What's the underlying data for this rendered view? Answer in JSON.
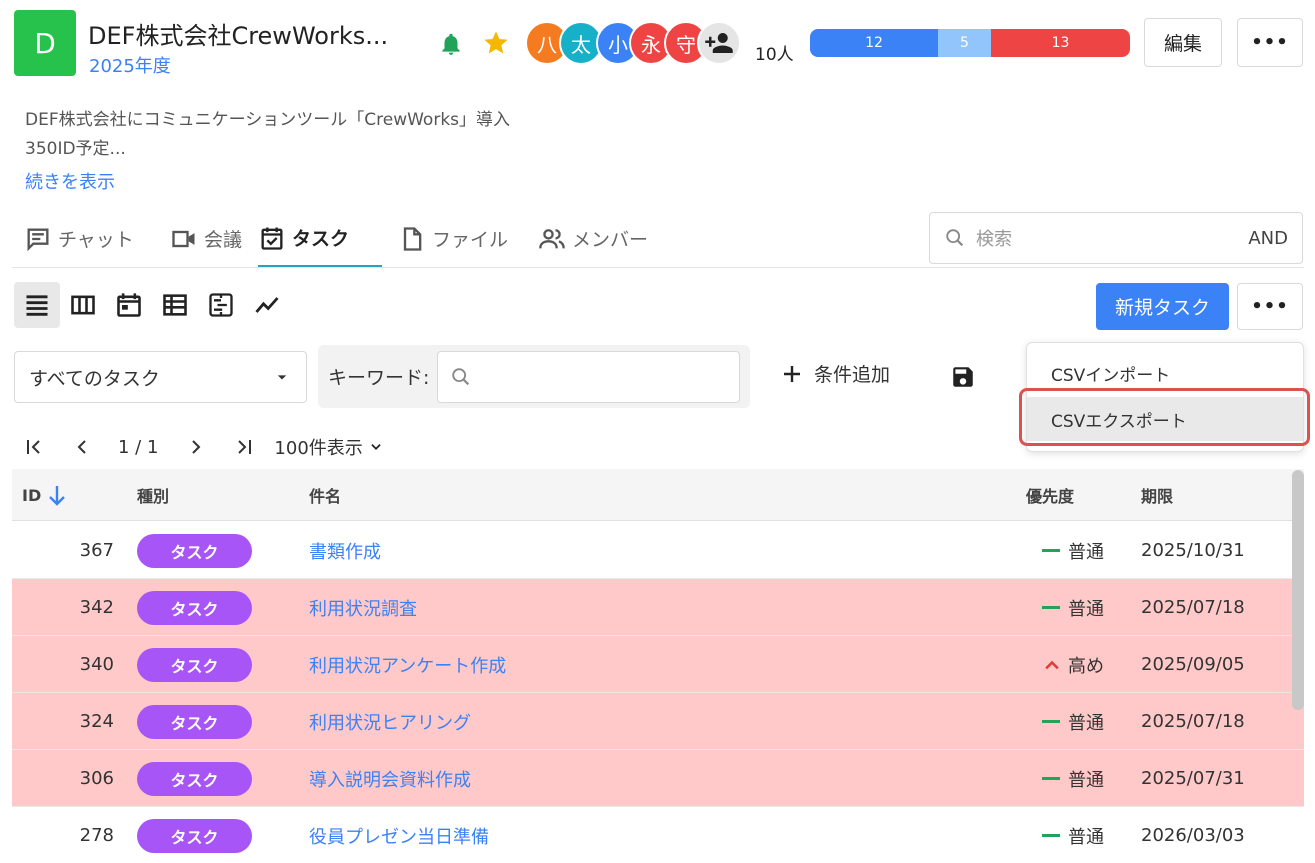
{
  "project": {
    "icon_letter": "D",
    "title": "DEF株式会社CrewWorks...",
    "year": "2025年度",
    "description_line1": "DEF株式会社にコミュニケーションツール「CrewWorks」導入",
    "description_line2": "350ID予定...",
    "show_more": "続きを表示",
    "member_count": "10人",
    "avatars": [
      {
        "char": "八",
        "color": "#f47b20"
      },
      {
        "char": "太",
        "color": "#16b0c8"
      },
      {
        "char": "小",
        "color": "#3b82f6"
      },
      {
        "char": "永",
        "color": "#ef4444"
      },
      {
        "char": "守",
        "color": "#ef4444"
      }
    ],
    "status_counts": [
      {
        "value": "12",
        "color": "#3b82f6"
      },
      {
        "value": "5",
        "color": "#93c5fd"
      },
      {
        "value": "13",
        "color": "#ef4444"
      }
    ],
    "edit_label": "編集",
    "more_label": "•••"
  },
  "tabs": [
    {
      "label": "チャット",
      "icon": "chat-icon"
    },
    {
      "label": "会議",
      "icon": "video-icon"
    },
    {
      "label": "タスク",
      "icon": "task-icon"
    },
    {
      "label": "ファイル",
      "icon": "file-icon"
    },
    {
      "label": "メンバー",
      "icon": "members-icon"
    }
  ],
  "search": {
    "placeholder": "検索",
    "mode": "AND"
  },
  "toolbar": {
    "new_task": "新規タスク",
    "more_label": "•••"
  },
  "filter": {
    "selected": "すべてのタスク",
    "keyword_label": "キーワード:",
    "add_condition": "条件追加"
  },
  "dropdown": {
    "items": [
      "CSVインポート",
      "CSVエクスポート"
    ]
  },
  "pager": {
    "page": "1 / 1",
    "per_page": "100件表示"
  },
  "table": {
    "headers": {
      "id": "ID",
      "type": "種別",
      "name": "件名",
      "priority": "優先度",
      "due": "期限"
    },
    "rows": [
      {
        "id": "367",
        "type": "タスク",
        "name": "書類作成",
        "priority": "普通",
        "due": "2025/10/31"
      },
      {
        "id": "342",
        "type": "タスク",
        "name": "利用状況調査",
        "priority": "普通",
        "due": "2025/07/18"
      },
      {
        "id": "340",
        "type": "タスク",
        "name": "利用状況アンケート作成",
        "priority": "高め",
        "due": "2025/09/05"
      },
      {
        "id": "324",
        "type": "タスク",
        "name": "利用状況ヒアリング",
        "priority": "普通",
        "due": "2025/07/18"
      },
      {
        "id": "306",
        "type": "タスク",
        "name": "導入説明会資料作成",
        "priority": "普通",
        "due": "2025/07/31"
      },
      {
        "id": "278",
        "type": "タスク",
        "name": "役員プレゼン当日準備",
        "priority": "普通",
        "due": "2026/03/03"
      }
    ]
  }
}
